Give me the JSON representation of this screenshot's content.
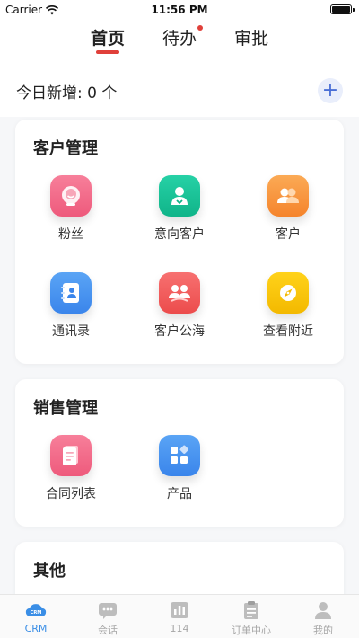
{
  "status_bar": {
    "carrier": "Carrier",
    "time": "11:56 PM"
  },
  "top_tabs": [
    {
      "label": "首页",
      "active": true,
      "badge": false
    },
    {
      "label": "待办",
      "active": false,
      "badge": true
    },
    {
      "label": "审批",
      "active": false,
      "badge": false
    }
  ],
  "header": {
    "today_text": "今日新增: 0 个",
    "add_label": "+"
  },
  "sections": {
    "customer": {
      "title": "客户管理",
      "items": [
        {
          "label": "粉丝",
          "icon": "fans-icon"
        },
        {
          "label": "意向客户",
          "icon": "intended-customer-icon"
        },
        {
          "label": "客户",
          "icon": "customer-icon"
        },
        {
          "label": "通讯录",
          "icon": "contacts-icon"
        },
        {
          "label": "客户公海",
          "icon": "customer-pool-icon"
        },
        {
          "label": "查看附近",
          "icon": "nearby-compass-icon"
        }
      ]
    },
    "sales": {
      "title": "销售管理",
      "items": [
        {
          "label": "合同列表",
          "icon": "contract-list-icon"
        },
        {
          "label": "产品",
          "icon": "product-icon"
        }
      ]
    },
    "other": {
      "title": "其他"
    }
  },
  "tab_bar": {
    "items": [
      {
        "label": "CRM",
        "icon": "crm-cloud-icon",
        "icon_text": "CRM",
        "active": true
      },
      {
        "label": "会话",
        "icon": "chat-icon",
        "active": false
      },
      {
        "label": "114",
        "icon": "stats-icon",
        "active": false
      },
      {
        "label": "订单中心",
        "icon": "order-clipboard-icon",
        "active": false
      },
      {
        "label": "我的",
        "icon": "profile-icon",
        "active": false
      }
    ]
  },
  "colors": {
    "accent_red": "#e0403a",
    "accent_blue": "#3a8ee6",
    "pink": "#f26b8a",
    "green": "#19c39a",
    "orange": "#f7983d",
    "blue": "#4a90f0",
    "red": "#f25a5a",
    "yellow": "#f5c400"
  }
}
